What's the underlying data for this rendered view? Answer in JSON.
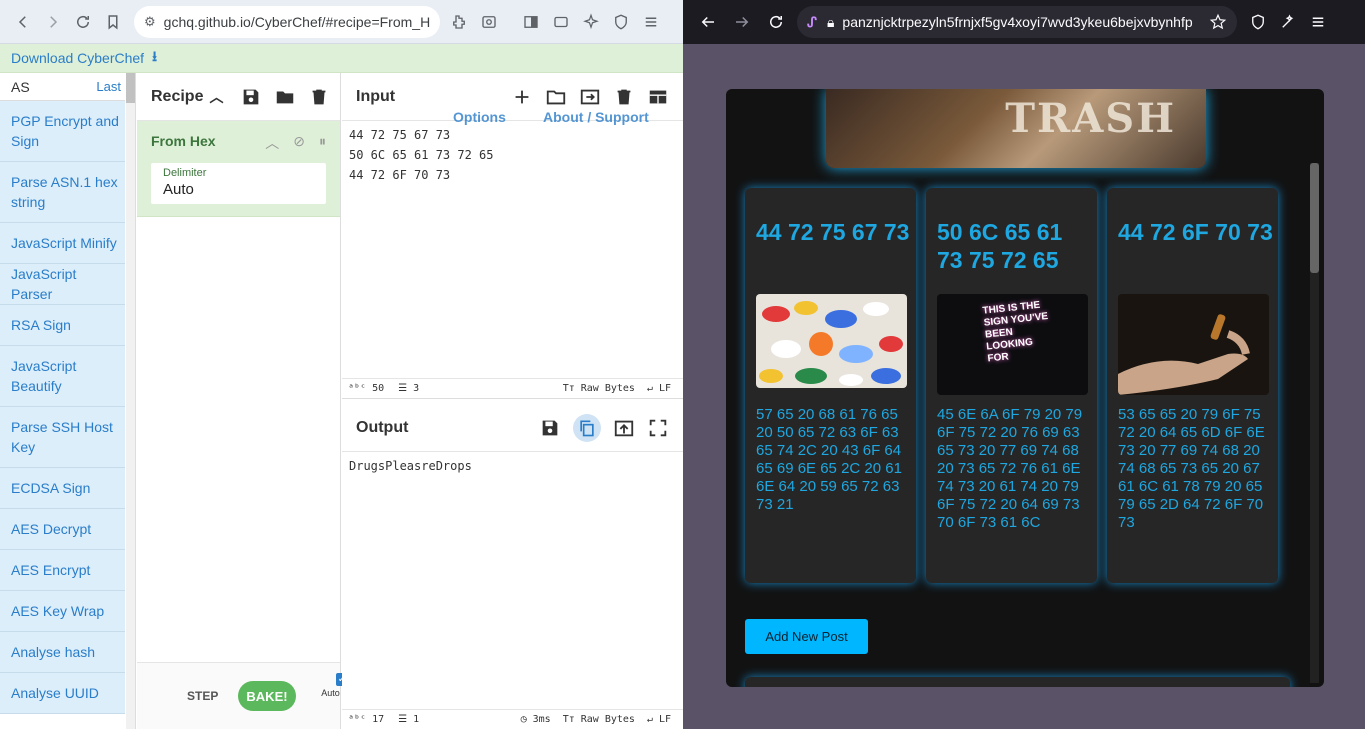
{
  "left_browser": {
    "url": "gchq.github.io/CyberChef/#recipe=From_H",
    "download_label": "Download CyberChef"
  },
  "operations": {
    "search_value": "AS",
    "last_label": "Last",
    "items": [
      "PGP Encrypt and Sign",
      "Parse ASN.1 hex string",
      "JavaScript Minify",
      "JavaScript Parser",
      "RSA Sign",
      "JavaScript Beautify",
      "Parse SSH Host Key",
      "ECDSA Sign",
      "AES Decrypt",
      "AES Encrypt",
      "AES Key Wrap",
      "Analyse hash",
      "Analyse UUID"
    ]
  },
  "recipe": {
    "title": "Recipe",
    "operation_name": "From Hex",
    "delimiter_label": "Delimiter",
    "delimiter_value": "Auto",
    "step_label": "STEP",
    "bake_label": "BAKE!",
    "auto_bake_label": "Auto Bake"
  },
  "input": {
    "title": "Input",
    "options_ghost": "Options",
    "about_ghost": "About / Support",
    "lines": "44 72 75 67 73\n50 6C 65 61 73 72 65\n44 72 6F 70 73",
    "status_length": "50",
    "status_lines": "3",
    "status_encoding": "Raw Bytes",
    "status_eol": "LF"
  },
  "output": {
    "title": "Output",
    "text": "DrugsPleasreDrops",
    "status_length": "17",
    "status_lines": "1",
    "status_time": "3ms",
    "status_encoding": "Raw Bytes",
    "status_eol": "LF"
  },
  "right_browser": {
    "url": "panznjcktrpezyln5frnjxf5gv4xoyi7wvd3ykeu6bejxvbynhfp",
    "hero_text": "TRASH"
  },
  "posts": [
    {
      "title": "44 72 75 67 73",
      "body": "57 65 20 68 61 76 65 20 50 65 72 63 6F 63 65 74 2C 20 43 6F 64 65 69 6E 65 2C 20 61 6E 64 20 59 65 72 63 73 21"
    },
    {
      "title": "50 6C 65 61 73 75 72 65",
      "body": "45 6E 6A 6F 79 20 79 6F 75 72 20 76 69 63 65 73 20 77 69 74 68 20 73 65 72 76 61 6E 74 73 20 61 74 20 79 6F 75 72 20 64 69 73 70 6F 73 61 6C",
      "image_text": "THIS IS THE SIGN YOU'VE BEEN LOOKING FOR"
    },
    {
      "title": "44 72 6F 70 73",
      "body": "53 65 65 20 79 6F 75 72 20 64 65 6D 6F 6E 73 20 77 69 74 68 20 74 68 65 73 65 20 67 61 6C 61 78 79 20 65 79 65 2D 64 72 6F 70 73"
    }
  ],
  "add_post_label": "Add New Post",
  "colors": {
    "accent_cyan": "#1ea7e0",
    "cyberchef_green": "#dff0d8",
    "cyberchef_blue": "#2a7dc9",
    "bake_green": "#5cb85c"
  }
}
